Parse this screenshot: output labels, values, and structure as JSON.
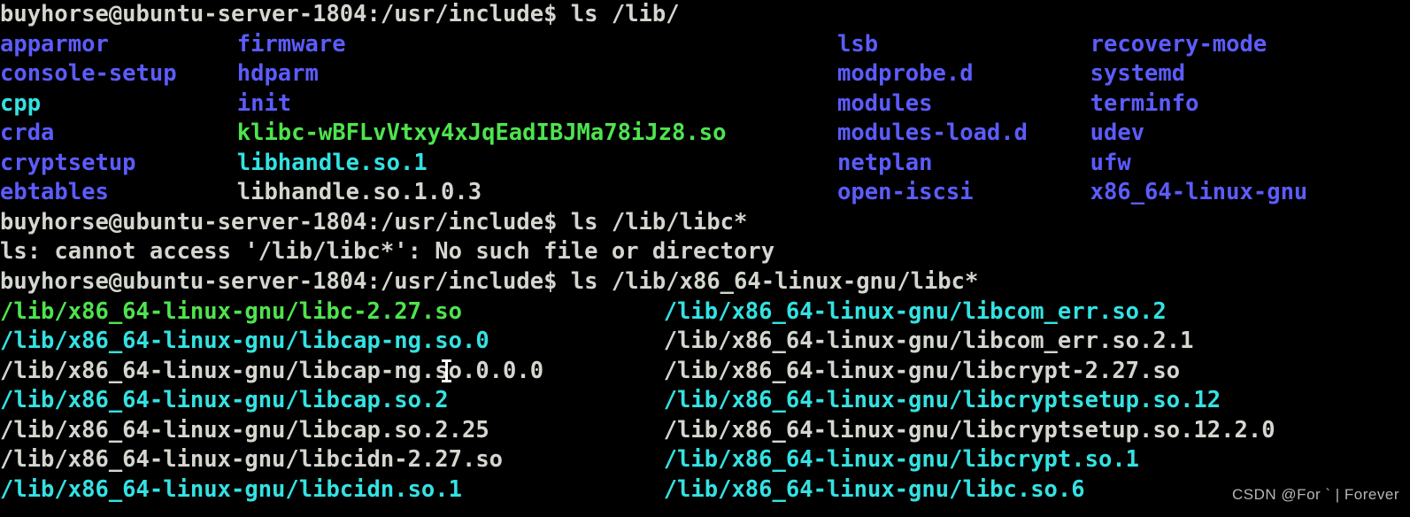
{
  "terminal": {
    "background": "#000000",
    "colors": {
      "default": "#d3d7cf",
      "directory": "#5c5cff",
      "symlink": "#34e2e2",
      "executable": "#4ee44e"
    },
    "char_width": 17.85,
    "line_height": 33.55,
    "prompt": "buyhorse@ubuntu-server-1804:/usr/include$",
    "user": "buyhorse",
    "host": "ubuntu-server-1804",
    "cwd": "/usr/include",
    "commands": [
      "ls /lib/",
      "ls /lib/libc*",
      "ls /lib/x86_64-linux-gnu/libc*"
    ],
    "error_message": "ls: cannot access '/lib/libc*': No such file or directory",
    "lines": [
      [
        {
          "col": 0,
          "text": "buyhorse@ubuntu-server-1804:/usr/include$ ls /lib/",
          "type": "default"
        }
      ],
      [
        {
          "col": 0,
          "text": "apparmor",
          "type": "directory"
        },
        {
          "col": 15,
          "text": "firmware",
          "type": "directory"
        },
        {
          "col": 53,
          "text": "lsb",
          "type": "directory"
        },
        {
          "col": 69,
          "text": "recovery-mode",
          "type": "directory"
        }
      ],
      [
        {
          "col": 0,
          "text": "console-setup",
          "type": "directory"
        },
        {
          "col": 15,
          "text": "hdparm",
          "type": "directory"
        },
        {
          "col": 53,
          "text": "modprobe.d",
          "type": "directory"
        },
        {
          "col": 69,
          "text": "systemd",
          "type": "directory"
        }
      ],
      [
        {
          "col": 0,
          "text": "cpp",
          "type": "symlink"
        },
        {
          "col": 15,
          "text": "init",
          "type": "directory"
        },
        {
          "col": 53,
          "text": "modules",
          "type": "directory"
        },
        {
          "col": 69,
          "text": "terminfo",
          "type": "directory"
        }
      ],
      [
        {
          "col": 0,
          "text": "crda",
          "type": "directory"
        },
        {
          "col": 15,
          "text": "klibc-wBFLvVtxy4xJqEadIBJMa78iJz8.so",
          "type": "executable"
        },
        {
          "col": 53,
          "text": "modules-load.d",
          "type": "directory"
        },
        {
          "col": 69,
          "text": "udev",
          "type": "directory"
        }
      ],
      [
        {
          "col": 0,
          "text": "cryptsetup",
          "type": "directory"
        },
        {
          "col": 15,
          "text": "libhandle.so.1",
          "type": "symlink"
        },
        {
          "col": 53,
          "text": "netplan",
          "type": "directory"
        },
        {
          "col": 69,
          "text": "ufw",
          "type": "directory"
        }
      ],
      [
        {
          "col": 0,
          "text": "ebtables",
          "type": "directory"
        },
        {
          "col": 15,
          "text": "libhandle.so.1.0.3",
          "type": "default"
        },
        {
          "col": 53,
          "text": "open-iscsi",
          "type": "directory"
        },
        {
          "col": 69,
          "text": "x86_64-linux-gnu",
          "type": "directory"
        }
      ],
      [
        {
          "col": 0,
          "text": "buyhorse@ubuntu-server-1804:/usr/include$ ls /lib/libc*",
          "type": "default"
        }
      ],
      [
        {
          "col": 0,
          "text": "ls: cannot access '/lib/libc*': No such file or directory",
          "type": "default"
        }
      ],
      [
        {
          "col": 0,
          "text": "buyhorse@ubuntu-server-1804:/usr/include$ ls /lib/x86_64-linux-gnu/libc*",
          "type": "default"
        }
      ],
      [
        {
          "col": 0,
          "text": "/lib/x86_64-linux-gnu/libc-2.27.so",
          "type": "executable"
        },
        {
          "col": 42,
          "text": "/lib/x86_64-linux-gnu/libcom_err.so.2",
          "type": "symlink"
        }
      ],
      [
        {
          "col": 0,
          "text": "/lib/x86_64-linux-gnu/libcap-ng.so.0",
          "type": "symlink"
        },
        {
          "col": 42,
          "text": "/lib/x86_64-linux-gnu/libcom_err.so.2.1",
          "type": "default"
        }
      ],
      [
        {
          "col": 0,
          "text": "/lib/x86_64-linux-gnu/libcap-ng.so.0.0.0",
          "type": "default"
        },
        {
          "col": 42,
          "text": "/lib/x86_64-linux-gnu/libcrypt-2.27.so",
          "type": "default"
        }
      ],
      [
        {
          "col": 0,
          "text": "/lib/x86_64-linux-gnu/libcap.so.2",
          "type": "symlink"
        },
        {
          "col": 42,
          "text": "/lib/x86_64-linux-gnu/libcryptsetup.so.12",
          "type": "symlink"
        }
      ],
      [
        {
          "col": 0,
          "text": "/lib/x86_64-linux-gnu/libcap.so.2.25",
          "type": "default"
        },
        {
          "col": 42,
          "text": "/lib/x86_64-linux-gnu/libcryptsetup.so.12.2.0",
          "type": "default"
        }
      ],
      [
        {
          "col": 0,
          "text": "/lib/x86_64-linux-gnu/libcidn-2.27.so",
          "type": "default"
        },
        {
          "col": 42,
          "text": "/lib/x86_64-linux-gnu/libcrypt.so.1",
          "type": "symlink"
        }
      ],
      [
        {
          "col": 0,
          "text": "/lib/x86_64-linux-gnu/libcidn.so.1",
          "type": "symlink"
        },
        {
          "col": 42,
          "text": "/lib/x86_64-linux-gnu/libc.so.6",
          "type": "symlink"
        }
      ]
    ]
  },
  "watermark": {
    "text": "CSDN @For ` | Forever"
  }
}
